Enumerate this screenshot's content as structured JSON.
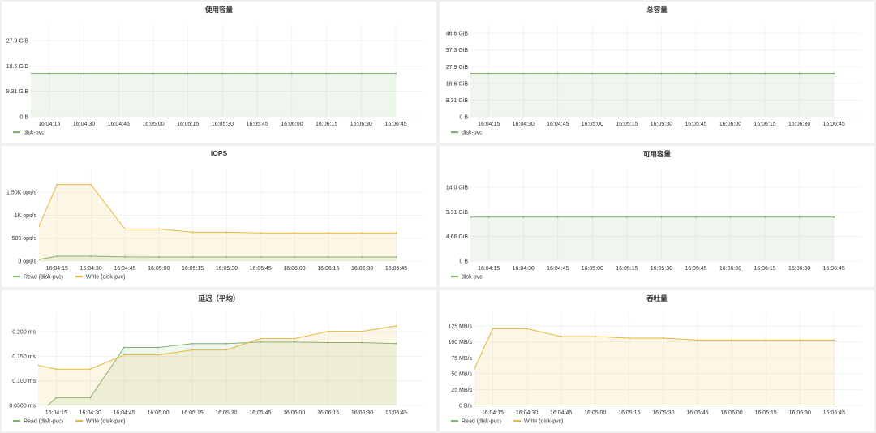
{
  "colors": {
    "read": "#7EB26D",
    "write": "#EAB839",
    "background": "#f0f0f0",
    "grid": "#ececec"
  },
  "chart_data": [
    {
      "type": "area",
      "title": "使用容量",
      "unit": "GiB",
      "x": [
        "16:04:07",
        "16:04:15",
        "16:04:30",
        "16:04:45",
        "16:05:00",
        "16:05:15",
        "16:05:30",
        "16:05:45",
        "16:06:00",
        "16:06:15",
        "16:06:30",
        "16:06:45"
      ],
      "xlim": [
        "16:04:07",
        "16:06:52"
      ],
      "xticks": [
        "16:04:15",
        "16:04:30",
        "16:04:45",
        "16:05:00",
        "16:05:15",
        "16:05:30",
        "16:05:45",
        "16:06:00",
        "16:06:15",
        "16:06:30",
        "16:06:45"
      ],
      "ylim": [
        0,
        33.3
      ],
      "yticks": [
        {
          "value": 0,
          "label": "0 B"
        },
        {
          "value": 9.31,
          "label": "9.31 GiB"
        },
        {
          "value": 18.6,
          "label": "18.6 GiB"
        },
        {
          "value": 27.9,
          "label": "27.9 GiB"
        }
      ],
      "grid": true,
      "legend_placement": "bottom-left",
      "series": [
        {
          "name": "disk-pvc",
          "color": "#7EB26D",
          "values": [
            15.9,
            15.9,
            15.9,
            15.9,
            15.9,
            15.9,
            15.9,
            15.9,
            15.9,
            15.9,
            15.9,
            15.9
          ]
        }
      ]
    },
    {
      "type": "area",
      "title": "总容量",
      "unit": "GiB",
      "x": [
        "16:04:07",
        "16:04:15",
        "16:04:30",
        "16:04:45",
        "16:05:00",
        "16:05:15",
        "16:05:30",
        "16:05:45",
        "16:06:00",
        "16:06:15",
        "16:06:30",
        "16:06:45"
      ],
      "xlim": [
        "16:04:07",
        "16:06:52"
      ],
      "xticks": [
        "16:04:15",
        "16:04:30",
        "16:04:45",
        "16:05:00",
        "16:05:15",
        "16:05:30",
        "16:05:45",
        "16:06:00",
        "16:06:15",
        "16:06:30",
        "16:06:45"
      ],
      "ylim": [
        0,
        50.7
      ],
      "yticks": [
        {
          "value": 0,
          "label": "0 B"
        },
        {
          "value": 9.31,
          "label": "9.31 GiB"
        },
        {
          "value": 18.6,
          "label": "18.6 GiB"
        },
        {
          "value": 27.9,
          "label": "27.9 GiB"
        },
        {
          "value": 37.3,
          "label": "37.3 GiB"
        },
        {
          "value": 46.6,
          "label": "46.6 GiB"
        }
      ],
      "grid": true,
      "legend_placement": "bottom-left",
      "series": [
        {
          "name": "disk-pvc",
          "color": "#7EB26D",
          "values": [
            24.2,
            24.2,
            24.2,
            24.2,
            24.2,
            24.2,
            24.2,
            24.2,
            24.2,
            24.2,
            24.2,
            24.2
          ]
        }
      ]
    },
    {
      "type": "area",
      "title": "IOPS",
      "unit": "ops/s",
      "x": [
        "16:04:07",
        "16:04:15",
        "16:04:30",
        "16:04:45",
        "16:05:00",
        "16:05:15",
        "16:05:30",
        "16:05:45",
        "16:06:00",
        "16:06:15",
        "16:06:30",
        "16:06:45"
      ],
      "xlim": [
        "16:04:07",
        "16:06:52"
      ],
      "xticks": [
        "16:04:15",
        "16:04:30",
        "16:04:45",
        "16:05:00",
        "16:05:15",
        "16:05:30",
        "16:05:45",
        "16:06:00",
        "16:06:15",
        "16:06:30",
        "16:06:45"
      ],
      "ylim": [
        0,
        1980
      ],
      "yticks": [
        {
          "value": 0,
          "label": "0 ops/s"
        },
        {
          "value": 500,
          "label": "500 ops/s"
        },
        {
          "value": 1000,
          "label": "1K ops/s"
        },
        {
          "value": 1500,
          "label": "1.50K ops/s"
        }
      ],
      "grid": true,
      "legend_placement": "bottom-left",
      "series": [
        {
          "name": "Read (disk-pvc)",
          "color": "#7EB26D",
          "values": [
            35,
            105,
            105,
            90,
            88,
            88,
            88,
            88,
            88,
            88,
            88,
            88
          ]
        },
        {
          "name": "Write (disk-pvc)",
          "color": "#EAB839",
          "values": [
            760,
            1667,
            1667,
            700,
            700,
            630,
            630,
            614,
            614,
            614,
            614,
            614
          ]
        }
      ]
    },
    {
      "type": "area",
      "title": "可用容量",
      "unit": "GiB",
      "x": [
        "16:04:07",
        "16:04:15",
        "16:04:30",
        "16:04:45",
        "16:05:00",
        "16:05:15",
        "16:05:30",
        "16:05:45",
        "16:06:00",
        "16:06:15",
        "16:06:30",
        "16:06:45"
      ],
      "xlim": [
        "16:04:07",
        "16:06:52"
      ],
      "xticks": [
        "16:04:15",
        "16:04:30",
        "16:04:45",
        "16:05:00",
        "16:05:15",
        "16:05:30",
        "16:05:45",
        "16:06:00",
        "16:06:15",
        "16:06:30",
        "16:06:45"
      ],
      "ylim": [
        0,
        17.2
      ],
      "yticks": [
        {
          "value": 0,
          "label": "0 B"
        },
        {
          "value": 4.66,
          "label": "4.66 GiB"
        },
        {
          "value": 9.31,
          "label": "9.31 GiB"
        },
        {
          "value": 14.0,
          "label": "14.0 GiB"
        }
      ],
      "grid": true,
      "legend_placement": "bottom-left",
      "series": [
        {
          "name": "disk-pvc",
          "color": "#7EB26D",
          "values": [
            8.34,
            8.34,
            8.34,
            8.34,
            8.34,
            8.34,
            8.34,
            8.34,
            8.34,
            8.34,
            8.34,
            8.34
          ]
        }
      ]
    },
    {
      "type": "area",
      "title": "延迟（平均）",
      "unit": "ms",
      "x": [
        "16:04:07",
        "16:04:15",
        "16:04:30",
        "16:04:45",
        "16:05:00",
        "16:05:15",
        "16:05:30",
        "16:05:45",
        "16:06:00",
        "16:06:15",
        "16:06:30",
        "16:06:45"
      ],
      "xlim": [
        "16:04:07",
        "16:06:52"
      ],
      "xticks": [
        "16:04:15",
        "16:04:30",
        "16:04:45",
        "16:05:00",
        "16:05:15",
        "16:05:30",
        "16:05:45",
        "16:06:00",
        "16:06:15",
        "16:06:30",
        "16:06:45"
      ],
      "ylim": [
        0.05,
        0.235
      ],
      "yticks": [
        {
          "value": 0.05,
          "label": "0.0500 ms"
        },
        {
          "value": 0.1,
          "label": "0.100 ms"
        },
        {
          "value": 0.15,
          "label": "0.150 ms"
        },
        {
          "value": 0.2,
          "label": "0.200 ms"
        }
      ],
      "grid": true,
      "legend_placement": "bottom-left",
      "series": [
        {
          "name": "Read (disk-pvc)",
          "color": "#7EB26D",
          "values": [
            0.032,
            0.066,
            0.066,
            0.168,
            0.168,
            0.176,
            0.176,
            0.179,
            0.179,
            0.178,
            0.178,
            0.176
          ]
        },
        {
          "name": "Write (disk-pvc)",
          "color": "#EAB839",
          "values": [
            0.132,
            0.124,
            0.124,
            0.153,
            0.153,
            0.163,
            0.163,
            0.186,
            0.186,
            0.201,
            0.201,
            0.212
          ]
        }
      ]
    },
    {
      "type": "area",
      "title": "吞吐量",
      "unit": "MB/s",
      "x": [
        "16:04:07",
        "16:04:15",
        "16:04:30",
        "16:04:45",
        "16:05:00",
        "16:05:15",
        "16:05:30",
        "16:05:45",
        "16:06:00",
        "16:06:15",
        "16:06:30",
        "16:06:45"
      ],
      "xlim": [
        "16:04:07",
        "16:06:52"
      ],
      "xticks": [
        "16:04:15",
        "16:04:30",
        "16:04:45",
        "16:05:00",
        "16:05:15",
        "16:05:30",
        "16:05:45",
        "16:06:00",
        "16:06:15",
        "16:06:30",
        "16:06:45"
      ],
      "ylim": [
        0,
        143
      ],
      "yticks": [
        {
          "value": 0,
          "label": "0 B/s"
        },
        {
          "value": 25,
          "label": "25 MB/s"
        },
        {
          "value": 50,
          "label": "50 MB/s"
        },
        {
          "value": 75,
          "label": "75 MB/s"
        },
        {
          "value": 100,
          "label": "100 MB/s"
        },
        {
          "value": 125,
          "label": "125 MB/s"
        }
      ],
      "grid": true,
      "legend_placement": "bottom-left",
      "series": [
        {
          "name": "Read (disk-pvc)",
          "color": "#7EB26D",
          "values": [
            0,
            0,
            0,
            0,
            0,
            0,
            0,
            0,
            0,
            0,
            0,
            0
          ]
        },
        {
          "name": "Write (disk-pvc)",
          "color": "#EAB839",
          "values": [
            58,
            120.8,
            120.8,
            108.5,
            108.5,
            106,
            106,
            103,
            103,
            103,
            103,
            103
          ]
        }
      ]
    }
  ]
}
